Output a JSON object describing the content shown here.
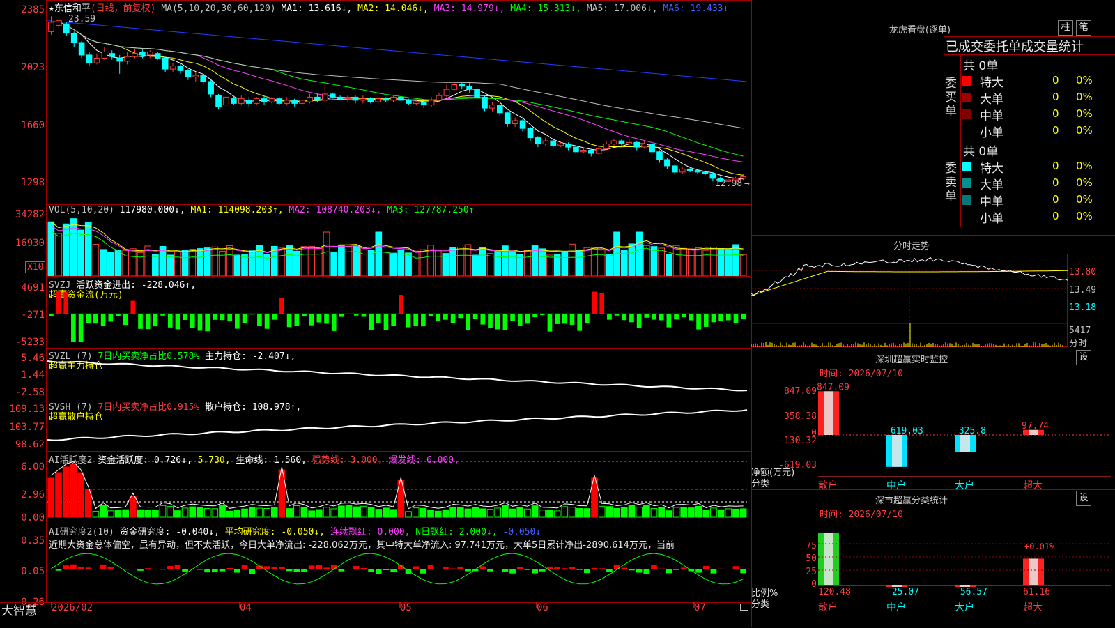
{
  "main": {
    "stock_name": "★东信和平",
    "period": "(日线，前复权)",
    "ma_label": "MA(5,10,20,30,60,120)",
    "ma1": "MA1: 13.616↓,",
    "ma2": "MA2: 14.046↓,",
    "ma3": "MA3: 14.979↓,",
    "ma4": "MA4: 15.313↓,",
    "ma5": "MA5: 17.006↓,",
    "ma6": "MA6: 19.433↓",
    "high_label": "23.59",
    "low_label": "12.98",
    "y_ticks": [
      "2385",
      "2023",
      "1660",
      "1298"
    ],
    "candles": [
      {
        "o": 22.6,
        "c": 23.2,
        "h": 23.59,
        "l": 22.4
      },
      {
        "o": 23.0,
        "c": 23.3,
        "h": 23.5,
        "l": 22.8
      },
      {
        "o": 23.1,
        "c": 22.5,
        "h": 23.2,
        "l": 22.3
      },
      {
        "o": 22.5,
        "c": 21.9,
        "h": 22.6,
        "l": 21.6
      },
      {
        "o": 21.9,
        "c": 21.1,
        "h": 22.0,
        "l": 20.9
      },
      {
        "o": 21.1,
        "c": 20.6,
        "h": 21.3,
        "l": 20.4
      },
      {
        "o": 20.6,
        "c": 20.9,
        "h": 21.2,
        "l": 20.5
      },
      {
        "o": 20.9,
        "c": 21.3,
        "h": 21.6,
        "l": 20.8
      },
      {
        "o": 21.2,
        "c": 21.0,
        "h": 21.4,
        "l": 20.8
      },
      {
        "o": 20.9,
        "c": 20.7,
        "h": 21.1,
        "l": 19.9
      },
      {
        "o": 20.7,
        "c": 21.0,
        "h": 21.3,
        "l": 20.5
      },
      {
        "o": 21.0,
        "c": 21.2,
        "h": 21.5,
        "l": 20.9
      },
      {
        "o": 21.3,
        "c": 21.1,
        "h": 21.5,
        "l": 20.9
      },
      {
        "o": 21.1,
        "c": 21.3,
        "h": 21.4,
        "l": 20.9
      },
      {
        "o": 21.2,
        "c": 20.9,
        "h": 21.3,
        "l": 20.8
      },
      {
        "o": 20.9,
        "c": 20.2,
        "h": 21.0,
        "l": 20.0
      },
      {
        "o": 20.2,
        "c": 20.4,
        "h": 20.6,
        "l": 20.0
      },
      {
        "o": 20.4,
        "c": 20.1,
        "h": 20.6,
        "l": 19.9
      },
      {
        "o": 20.1,
        "c": 19.7,
        "h": 20.2,
        "l": 19.5
      },
      {
        "o": 19.7,
        "c": 19.8,
        "h": 20.0,
        "l": 19.4
      },
      {
        "o": 19.8,
        "c": 19.4,
        "h": 19.9,
        "l": 19.2
      },
      {
        "o": 19.4,
        "c": 18.6,
        "h": 19.5,
        "l": 18.4
      },
      {
        "o": 18.5,
        "c": 17.8,
        "h": 18.6,
        "l": 17.6
      },
      {
        "o": 17.9,
        "c": 18.4,
        "h": 18.6,
        "l": 17.8
      },
      {
        "o": 18.3,
        "c": 18.0,
        "h": 18.5,
        "l": 17.9
      },
      {
        "o": 18.0,
        "c": 18.3,
        "h": 18.5,
        "l": 17.9
      },
      {
        "o": 18.2,
        "c": 18.0,
        "h": 18.4,
        "l": 17.8
      },
      {
        "o": 18.0,
        "c": 18.3,
        "h": 18.4,
        "l": 17.9
      },
      {
        "o": 18.3,
        "c": 18.1,
        "h": 18.5,
        "l": 17.9
      },
      {
        "o": 18.1,
        "c": 18.3,
        "h": 18.4,
        "l": 18.0
      },
      {
        "o": 18.3,
        "c": 18.0,
        "h": 18.4,
        "l": 17.9
      },
      {
        "o": 18.0,
        "c": 18.2,
        "h": 18.4,
        "l": 17.9
      },
      {
        "o": 18.2,
        "c": 18.0,
        "h": 18.3,
        "l": 17.8
      },
      {
        "o": 18.0,
        "c": 18.2,
        "h": 18.3,
        "l": 17.9
      },
      {
        "o": 18.1,
        "c": 18.4,
        "h": 18.6,
        "l": 18.0
      },
      {
        "o": 18.4,
        "c": 18.2,
        "h": 18.6,
        "l": 18.1
      },
      {
        "o": 18.2,
        "c": 18.6,
        "h": 19.3,
        "l": 18.1
      },
      {
        "o": 18.6,
        "c": 18.4,
        "h": 18.7,
        "l": 18.3
      },
      {
        "o": 18.4,
        "c": 18.3,
        "h": 18.5,
        "l": 18.2
      },
      {
        "o": 18.3,
        "c": 18.4,
        "h": 18.5,
        "l": 18.1
      },
      {
        "o": 18.4,
        "c": 18.2,
        "h": 18.5,
        "l": 18.0
      },
      {
        "o": 18.2,
        "c": 18.3,
        "h": 18.5,
        "l": 18.0
      },
      {
        "o": 18.3,
        "c": 18.1,
        "h": 18.4,
        "l": 18.0
      },
      {
        "o": 18.1,
        "c": 18.3,
        "h": 18.4,
        "l": 18.0
      },
      {
        "o": 18.3,
        "c": 18.2,
        "h": 18.4,
        "l": 18.1
      },
      {
        "o": 18.2,
        "c": 18.4,
        "h": 18.5,
        "l": 18.1
      },
      {
        "o": 18.4,
        "c": 18.2,
        "h": 18.5,
        "l": 18.1
      },
      {
        "o": 18.2,
        "c": 18.0,
        "h": 18.3,
        "l": 17.9
      },
      {
        "o": 18.0,
        "c": 18.1,
        "h": 18.3,
        "l": 17.9
      },
      {
        "o": 18.1,
        "c": 17.9,
        "h": 18.2,
        "l": 17.7
      },
      {
        "o": 17.9,
        "c": 18.2,
        "h": 18.4,
        "l": 17.8
      },
      {
        "o": 18.2,
        "c": 18.5,
        "h": 18.7,
        "l": 18.1
      },
      {
        "o": 18.5,
        "c": 18.9,
        "h": 19.2,
        "l": 18.4
      },
      {
        "o": 18.9,
        "c": 19.2,
        "h": 19.3,
        "l": 18.8
      },
      {
        "o": 19.2,
        "c": 19.1,
        "h": 19.4,
        "l": 18.9
      },
      {
        "o": 19.1,
        "c": 18.9,
        "h": 19.3,
        "l": 18.7
      },
      {
        "o": 18.9,
        "c": 18.4,
        "h": 19.0,
        "l": 18.3
      },
      {
        "o": 18.4,
        "c": 17.7,
        "h": 18.5,
        "l": 17.5
      },
      {
        "o": 17.7,
        "c": 17.9,
        "h": 18.1,
        "l": 17.5
      },
      {
        "o": 17.9,
        "c": 17.4,
        "h": 18.0,
        "l": 17.2
      },
      {
        "o": 17.4,
        "c": 16.7,
        "h": 17.5,
        "l": 16.5
      },
      {
        "o": 16.7,
        "c": 16.9,
        "h": 17.1,
        "l": 16.5
      },
      {
        "o": 16.9,
        "c": 16.4,
        "h": 17.0,
        "l": 16.2
      },
      {
        "o": 16.4,
        "c": 15.8,
        "h": 16.5,
        "l": 15.6
      },
      {
        "o": 15.8,
        "c": 15.4,
        "h": 15.9,
        "l": 15.2
      },
      {
        "o": 15.4,
        "c": 15.6,
        "h": 15.8,
        "l": 15.3
      },
      {
        "o": 15.6,
        "c": 15.3,
        "h": 15.7,
        "l": 15.1
      },
      {
        "o": 15.3,
        "c": 15.4,
        "h": 15.6,
        "l": 15.2
      },
      {
        "o": 15.4,
        "c": 15.2,
        "h": 15.5,
        "l": 15.0
      },
      {
        "o": 15.2,
        "c": 14.9,
        "h": 15.3,
        "l": 14.6
      },
      {
        "o": 14.9,
        "c": 15.0,
        "h": 15.2,
        "l": 14.8
      },
      {
        "o": 15.0,
        "c": 14.8,
        "h": 15.1,
        "l": 14.6
      },
      {
        "o": 14.8,
        "c": 15.1,
        "h": 15.3,
        "l": 14.7
      },
      {
        "o": 15.1,
        "c": 15.4,
        "h": 15.6,
        "l": 15.0
      },
      {
        "o": 15.4,
        "c": 15.6,
        "h": 15.7,
        "l": 15.3
      },
      {
        "o": 15.6,
        "c": 15.4,
        "h": 15.7,
        "l": 15.3
      },
      {
        "o": 15.4,
        "c": 15.5,
        "h": 15.7,
        "l": 15.3
      },
      {
        "o": 15.5,
        "c": 15.2,
        "h": 15.6,
        "l": 15.0
      },
      {
        "o": 15.2,
        "c": 15.4,
        "h": 15.6,
        "l": 15.1
      },
      {
        "o": 15.4,
        "c": 14.9,
        "h": 15.5,
        "l": 14.7
      },
      {
        "o": 14.9,
        "c": 14.4,
        "h": 15.0,
        "l": 14.2
      },
      {
        "o": 14.4,
        "c": 14.0,
        "h": 14.5,
        "l": 13.8
      },
      {
        "o": 14.0,
        "c": 13.6,
        "h": 14.1,
        "l": 13.5
      },
      {
        "o": 13.6,
        "c": 13.8,
        "h": 13.9,
        "l": 13.5
      },
      {
        "o": 13.8,
        "c": 13.7,
        "h": 13.9,
        "l": 13.6
      },
      {
        "o": 13.7,
        "c": 13.6,
        "h": 13.8,
        "l": 13.5
      },
      {
        "o": 13.6,
        "c": 13.5,
        "h": 13.7,
        "l": 13.4
      },
      {
        "o": 13.5,
        "c": 13.2,
        "h": 13.6,
        "l": 13.0
      },
      {
        "o": 13.2,
        "c": 13.0,
        "h": 13.3,
        "l": 12.98
      },
      {
        "o": 13.0,
        "c": 13.1,
        "h": 13.2,
        "l": 12.98
      },
      {
        "o": 13.1,
        "c": 13.2,
        "h": 13.3,
        "l": 13.0
      },
      {
        "o": 13.2,
        "c": 13.3,
        "h": 13.5,
        "l": 13.1
      }
    ]
  },
  "vol": {
    "label": "VOL(5,10,20)",
    "value": "117980.000↓,",
    "ma1": "MA1: 114098.203↑,",
    "ma2": "MA2: 108740.203↓,",
    "ma3": "MA3: 127787.250↑",
    "y_ticks": [
      "34282",
      "16930"
    ],
    "unit_badge": "X10"
  },
  "svzj": {
    "label": "SVZJ",
    "text1": "活跃资金进出: -228.046↑,",
    "text2": "超赢资金流(万元)",
    "y_ticks": [
      "4691",
      "-271",
      "-5233"
    ]
  },
  "svzl": {
    "label": "SVZL (7)",
    "text1": "7日内买卖净占比0.578%",
    "text2": "主力持仓: -2.407↓,",
    "text3": "超赢主力持仓",
    "y_ticks": [
      "5.46",
      "1.44",
      "-2.58"
    ]
  },
  "svsh": {
    "label": "SVSH (7)",
    "text1": "7日内买卖净占比0.915%",
    "text2": "散户持仓: 108.978↑,",
    "text3": "超赢散户持仓",
    "y_ticks": [
      "109.13",
      "103.77",
      "98.62"
    ]
  },
  "ai_act": {
    "label": "AI活跃度2",
    "text1": "资金活跃度: 0.726↓,",
    "text2": "5.730,",
    "text3": "生命线: 1.560,",
    "text4": "强势线: 3.000,",
    "text5": "爆发线: 6.000,",
    "y_ticks": [
      "6.00",
      "2.96",
      "0.00"
    ]
  },
  "ai_res": {
    "label": "AI研究度2(10)",
    "text1": "资金研究度: -0.040↓,",
    "text2": "平均研究度: -0.050↓,",
    "text3": "连续飘红: 0.000,",
    "text4": "N日飘红: 2.000↓,",
    "text5": "-0.050↓",
    "comment": "近期大资金总体偏空，虽有异动，但不太活跃，今日大单净流出: -228.062万元，其中特大单净流入: 97.741万元，大单5日累计净出-2890.614万元，当前",
    "y_ticks": [
      "0.35",
      "0.05",
      "-0.26"
    ]
  },
  "x_axis": {
    "brand": "大智慧",
    "labels": [
      "2026/02",
      "04",
      "05",
      "06",
      "07"
    ]
  },
  "right": {
    "lhb_title": "龙虎看盘(逐单)",
    "btn_zhu": "柱",
    "btn_bi": "笔",
    "stats_title": "已成交委托单成交量统计",
    "buy_group_label": "委买单",
    "sell_group_label": "委卖单",
    "buy_total": "共 0单",
    "sell_total": "共 0单",
    "buy_rows": [
      {
        "name": "特大",
        "count": "0",
        "pct": "0%",
        "color": "#ff0000"
      },
      {
        "name": "大单",
        "count": "0",
        "pct": "0%",
        "color": "#a00000"
      },
      {
        "name": "中单",
        "count": "0",
        "pct": "0%",
        "color": "#800000"
      },
      {
        "name": "小单",
        "count": "0",
        "pct": "0%",
        "color": "#000000"
      }
    ],
    "sell_rows": [
      {
        "name": "特大",
        "count": "0",
        "pct": "0%",
        "color": "#00ffff"
      },
      {
        "name": "大单",
        "count": "0",
        "pct": "0%",
        "color": "#009090"
      },
      {
        "name": "中单",
        "count": "0",
        "pct": "0%",
        "color": "#007878"
      },
      {
        "name": "小单",
        "count": "0",
        "pct": "0%",
        "color": "#000000"
      }
    ],
    "intraday_title": "分时走势",
    "intraday_ticks": [
      "13.80",
      "13.49",
      "13.18"
    ],
    "intraday_vol_tick": "5417",
    "intraday_vol_label": "分时",
    "monitor_title": "深圳超赢实时监控",
    "monitor_btn": "设",
    "monitor_time": "时间: 2026/07/10",
    "monitor_ticks": [
      "847.09",
      "358.38",
      "0",
      "-130.32",
      "-619.03"
    ],
    "monitor_ylabel1": "净额(万元)",
    "monitor_ylabel2": "分类",
    "monitor_bars": [
      {
        "label": "847.09",
        "value": 847.09,
        "cat": "散户"
      },
      {
        "label": "-619.03",
        "value": -619.03,
        "cat": "中户"
      },
      {
        "label": "-325.8",
        "value": -325.8,
        "cat": "大户"
      },
      {
        "label": "97.74",
        "value": 97.74,
        "cat": "超大"
      }
    ],
    "class_title": "深市超赢分类统计",
    "class_btn": "设",
    "class_time": "时间: 2026/07/10",
    "class_ticks": [
      "75",
      "50",
      "25",
      "0"
    ],
    "class_ylabel1": "比例%",
    "class_ylabel2": "分类",
    "class_bars": [
      {
        "label": "120.48",
        "value": 120.48,
        "cat": "散户"
      },
      {
        "label": "-25.07",
        "value": -25.07,
        "cat": "中户"
      },
      {
        "label": "-56.57",
        "value": -56.57,
        "cat": "大户"
      },
      {
        "label": "61.16",
        "value": 61.16,
        "cat": "超大"
      }
    ],
    "class_note": "+0.01%"
  }
}
